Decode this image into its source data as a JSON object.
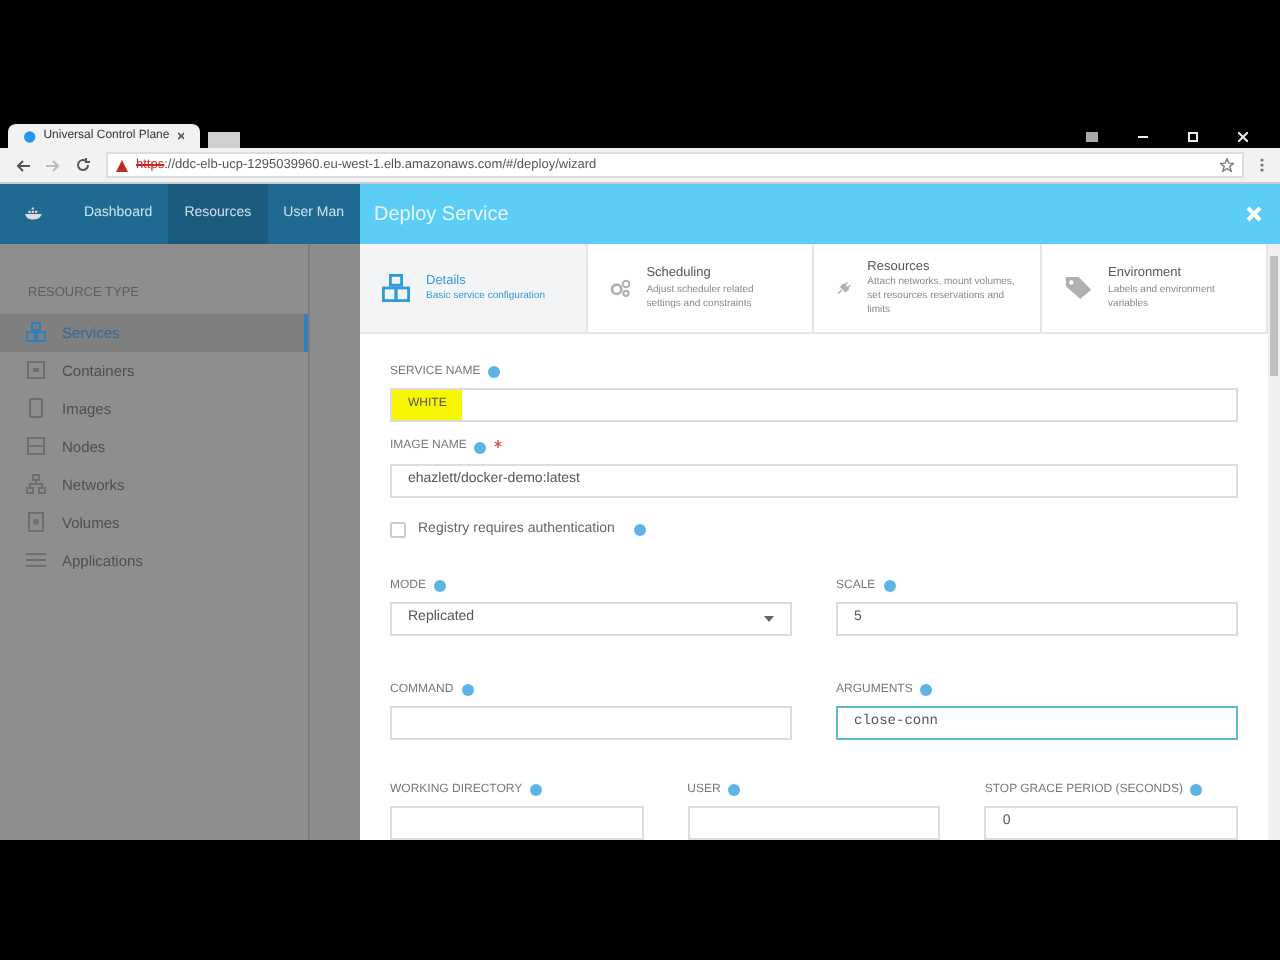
{
  "browser": {
    "tab_title": "Universal Control Plane",
    "address": {
      "scheme": "https",
      "rest": "://ddc-elb-ucp-1295039960.eu-west-1.elb.amazonaws.com/#/deploy/wizard"
    }
  },
  "nav": {
    "items": [
      {
        "label": "Dashboard",
        "selected": false
      },
      {
        "label": "Resources",
        "selected": true
      },
      {
        "label": "User Man",
        "selected": false
      }
    ]
  },
  "sidebar": {
    "heading": "RESOURCE TYPE",
    "items": [
      {
        "label": "Services",
        "kind": "services",
        "selected": true
      },
      {
        "label": "Containers",
        "kind": "containers",
        "selected": false
      },
      {
        "label": "Images",
        "kind": "images",
        "selected": false
      },
      {
        "label": "Nodes",
        "kind": "nodes",
        "selected": false
      },
      {
        "label": "Networks",
        "kind": "networks",
        "selected": false
      },
      {
        "label": "Volumes",
        "kind": "volumes",
        "selected": false
      },
      {
        "label": "Applications",
        "kind": "applications",
        "selected": false
      }
    ]
  },
  "modal": {
    "title": "Deploy Service",
    "steps": [
      {
        "title": "Details",
        "description": "Basic service configuration",
        "kind": "details",
        "selected": true
      },
      {
        "title": "Scheduling",
        "description": "Adjust scheduler related settings and constraints",
        "kind": "scheduling",
        "selected": false
      },
      {
        "title": "Resources",
        "description": "Attach networks, mount volumes, set resources reservations and limits",
        "kind": "resources",
        "selected": false
      },
      {
        "title": "Environment",
        "description": "Labels and environment variables",
        "kind": "environment",
        "selected": false
      }
    ],
    "form": {
      "service_name": {
        "label": "SERVICE NAME",
        "value": "WHITE",
        "highlighted": true
      },
      "image_name": {
        "label": "IMAGE NAME",
        "value": "ehazlett/docker-demo:latest",
        "required": true
      },
      "registry_auth": {
        "label": "Registry requires authentication",
        "checked": false
      },
      "mode": {
        "label": "MODE",
        "value": "Replicated"
      },
      "scale": {
        "label": "SCALE",
        "value": "5"
      },
      "command": {
        "label": "COMMAND"
      },
      "arguments": {
        "label": "ARGUMENTS",
        "value": "close-conn",
        "focused": true
      },
      "working_directory": {
        "label": "WORKING DIRECTORY"
      },
      "user": {
        "label": "USER"
      },
      "stop_grace_period": {
        "label": "STOP GRACE PERIOD (SECONDS)",
        "value": "0"
      }
    }
  }
}
